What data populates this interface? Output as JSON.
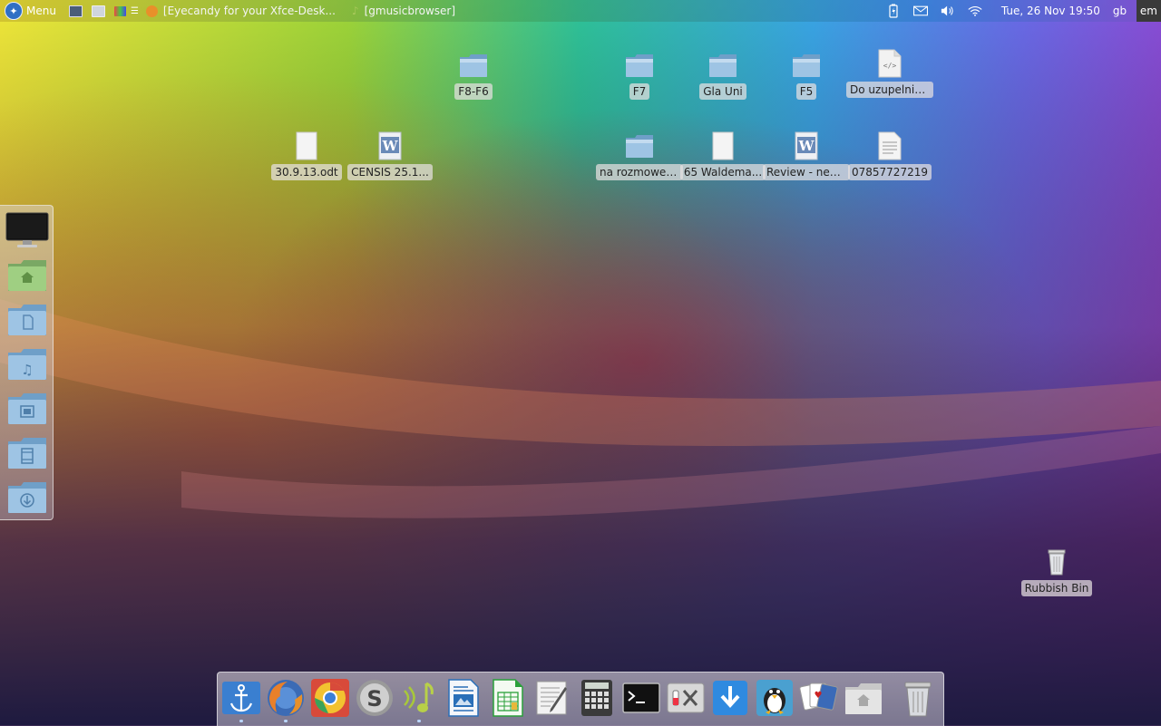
{
  "top_panel": {
    "menu_label": "Menu",
    "tasks": [
      {
        "title": "[Eyecandy for your Xfce-Desk..."
      },
      {
        "title": "[gmusicbrowser]"
      }
    ],
    "clock": "Tue, 26 Nov  19:50",
    "keyboard_layouts": [
      "gb",
      "em"
    ]
  },
  "desktop": {
    "icons": [
      {
        "label": "F8-F6",
        "type": "folder"
      },
      {
        "label": "F7",
        "type": "folder"
      },
      {
        "label": "Gla Uni",
        "type": "folder"
      },
      {
        "label": "F5",
        "type": "folder"
      },
      {
        "label": "Do uzupelnie...",
        "type": "html-file"
      },
      {
        "label": "30.9.13.odt",
        "type": "blank-file"
      },
      {
        "label": "CENSIS 25.1...",
        "type": "word-doc"
      },
      {
        "label": "na rozmowe ...",
        "type": "folder"
      },
      {
        "label": "65 Waldema...",
        "type": "blank-file"
      },
      {
        "label": "Review - neg...",
        "type": "word-doc"
      },
      {
        "label": "07857727219",
        "type": "text-file"
      },
      {
        "label": "Rubbish Bin",
        "type": "trash"
      }
    ]
  },
  "side_dock": {
    "items": [
      "computer-icon",
      "home-folder-icon",
      "documents-folder-icon",
      "music-folder-icon",
      "pictures-folder-icon",
      "videos-folder-icon",
      "downloads-folder-icon"
    ]
  },
  "bottom_dock": {
    "items": [
      "anchor-icon",
      "firefox-icon",
      "chrome-icon",
      "skype-icon",
      "music-player-icon",
      "writer-icon",
      "calc-icon",
      "text-editor-icon",
      "calculator-icon",
      "terminal-icon",
      "settings-icon",
      "download-icon",
      "penguin-icon",
      "cards-icon",
      "home-folder-icon",
      "trash-icon"
    ]
  },
  "colors": {
    "folder_blue": "#8fb6d9",
    "label_bg": "#e6e1e1",
    "panel_text": "#ffffff"
  }
}
